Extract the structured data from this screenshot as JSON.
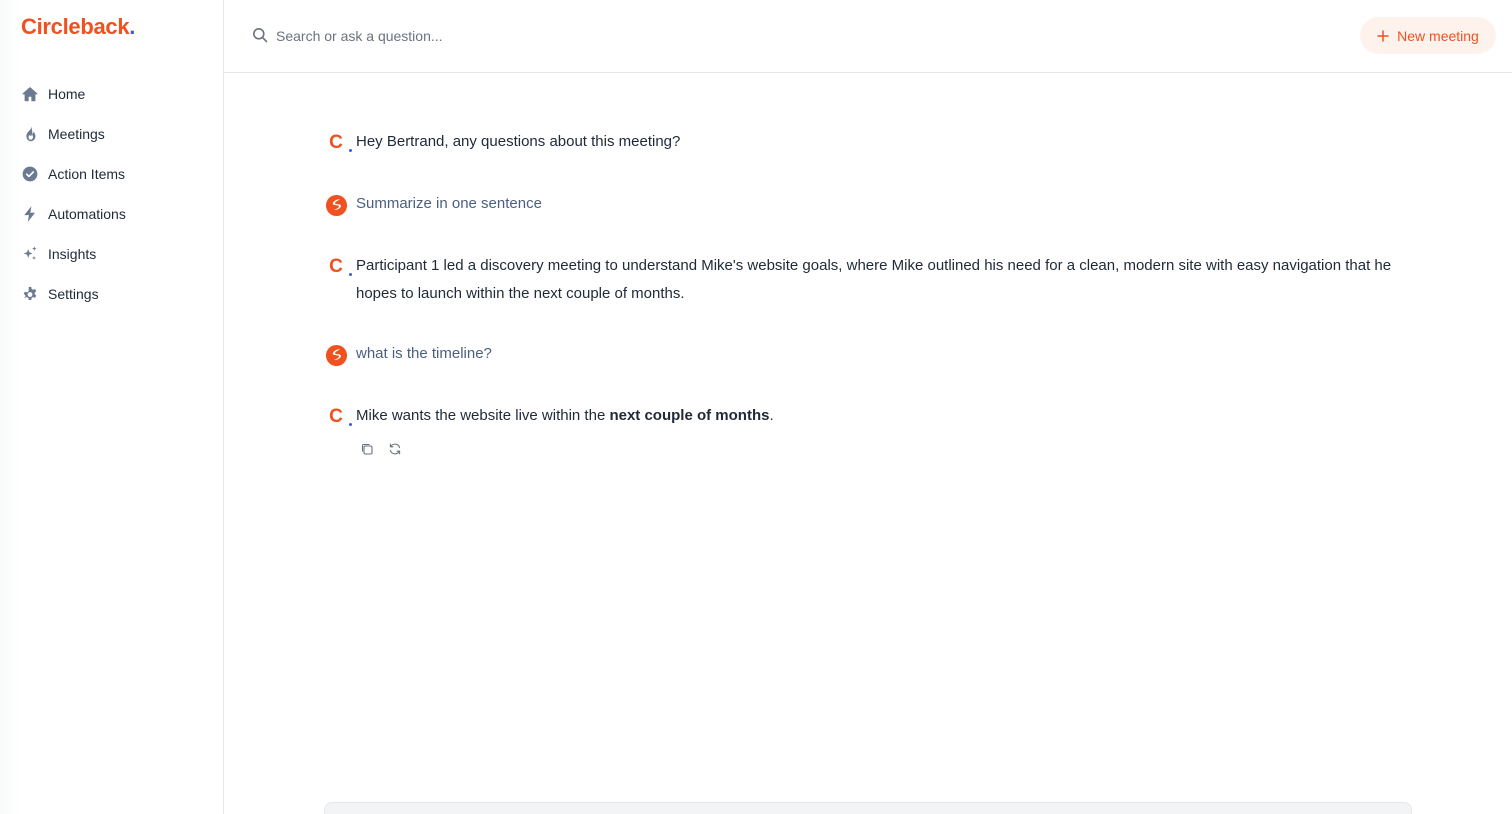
{
  "app": {
    "logo_text": "Circleback",
    "logo_dot": ".",
    "brand_color": "#f0511f",
    "dot_color": "#3b5bdb"
  },
  "sidebar": {
    "items": [
      {
        "label": "Home",
        "icon": "home-icon"
      },
      {
        "label": "Meetings",
        "icon": "flame-icon"
      },
      {
        "label": "Action Items",
        "icon": "check-circle-icon"
      },
      {
        "label": "Automations",
        "icon": "bolt-icon"
      },
      {
        "label": "Insights",
        "icon": "sparkles-icon"
      },
      {
        "label": "Settings",
        "icon": "gear-icon"
      }
    ]
  },
  "topbar": {
    "search_placeholder": "Search or ask a question...",
    "new_meeting_label": "New meeting"
  },
  "chat": {
    "messages": [
      {
        "role": "assistant",
        "text": "Hey Bertrand, any questions about this meeting?"
      },
      {
        "role": "user",
        "text": "Summarize in one sentence"
      },
      {
        "role": "assistant",
        "text": "Participant 1 led a discovery meeting to understand Mike's website goals, where Mike outlined his need for a clean, modern site with easy navigation that he hopes to launch within the next couple of months."
      },
      {
        "role": "user",
        "text": "what is the timeline?"
      },
      {
        "role": "assistant",
        "text_before": "Mike wants the website live within the ",
        "text_bold": "next couple of months",
        "text_after": "."
      }
    ],
    "actions": [
      "copy-icon",
      "refresh-icon"
    ]
  }
}
